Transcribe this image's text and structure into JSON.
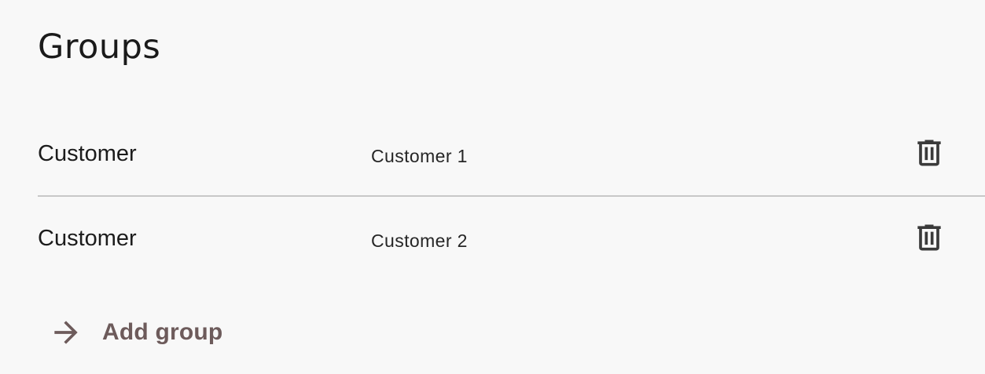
{
  "page": {
    "title": "Groups"
  },
  "groups": [
    {
      "type": "Customer",
      "name": "Customer 1"
    },
    {
      "type": "Customer",
      "name": "Customer 2"
    }
  ],
  "actions": {
    "add_group_label": "Add group"
  },
  "icons": {
    "delete": "trash-icon",
    "add": "arrow-right-icon"
  },
  "colors": {
    "background": "#f8f8f8",
    "accent": "#6d5b5b",
    "divider": "#c8c8c8",
    "icon": "#3a3a3a"
  }
}
